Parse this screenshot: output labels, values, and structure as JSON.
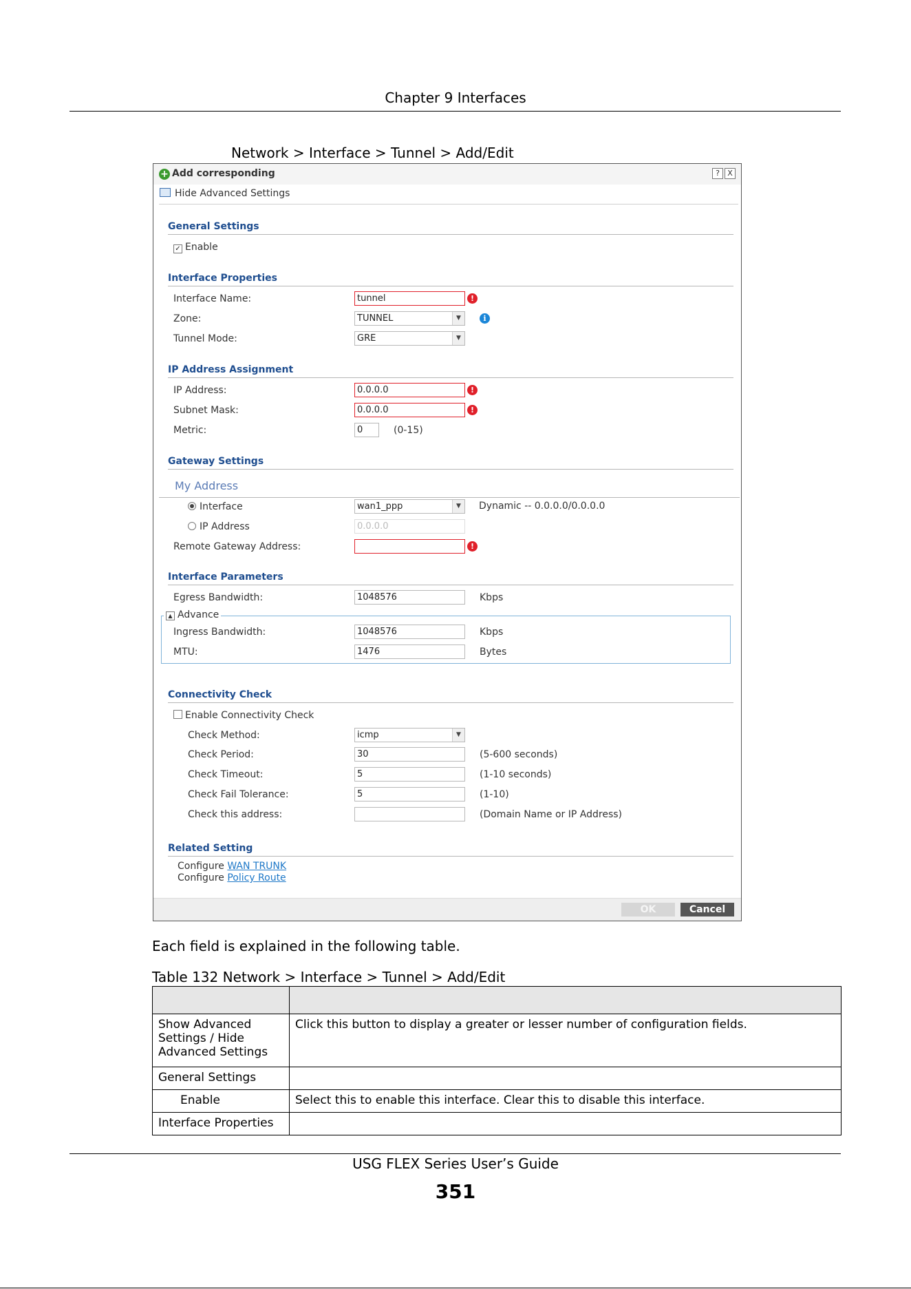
{
  "header": {
    "chapter": "Chapter 9 Interfaces"
  },
  "figure_caption": "Network > Interface > Tunnel > Add/Edit",
  "dialog": {
    "title": "Add corresponding",
    "help_btn": "?",
    "close_btn": "X",
    "adv_toggle": "Hide Advanced Settings",
    "general": {
      "title": "General Settings",
      "enable_label": "Enable",
      "enable_checked": true
    },
    "iface_props": {
      "title": "Interface Properties",
      "name_label": "Interface Name:",
      "name_value": "tunnel",
      "zone_label": "Zone:",
      "zone_value": "TUNNEL",
      "mode_label": "Tunnel Mode:",
      "mode_value": "GRE"
    },
    "ip_assign": {
      "title": "IP Address Assignment",
      "ip_label": "IP Address:",
      "ip_value": "0.0.0.0",
      "mask_label": "Subnet Mask:",
      "mask_value": "0.0.0.0",
      "metric_label": "Metric:",
      "metric_value": "0",
      "metric_hint": "(0-15)"
    },
    "gateway": {
      "title": "Gateway Settings",
      "my_address": "My Address",
      "iface_radio": "Interface",
      "iface_value": "wan1_ppp",
      "dynamic_text": "Dynamic -- 0.0.0.0/0.0.0.0",
      "ip_radio": "IP Address",
      "ip_value": "0.0.0.0",
      "remote_label": "Remote Gateway Address:",
      "remote_value": ""
    },
    "params": {
      "title": "Interface Parameters",
      "egress_label": "Egress Bandwidth:",
      "egress_value": "1048576",
      "egress_unit": "Kbps",
      "advance_label": "Advance",
      "ingress_label": "Ingress Bandwidth:",
      "ingress_value": "1048576",
      "ingress_unit": "Kbps",
      "mtu_label": "MTU:",
      "mtu_value": "1476",
      "mtu_unit": "Bytes"
    },
    "conn": {
      "title": "Connectivity Check",
      "enable_label": "Enable Connectivity Check",
      "enable_checked": false,
      "method_label": "Check Method:",
      "method_value": "icmp",
      "period_label": "Check Period:",
      "period_value": "30",
      "period_hint": "(5-600 seconds)",
      "timeout_label": "Check Timeout:",
      "timeout_value": "5",
      "timeout_hint": "(1-10 seconds)",
      "fail_label": "Check Fail Tolerance:",
      "fail_value": "5",
      "fail_hint": "(1-10)",
      "addr_label": "Check this address:",
      "addr_value": "",
      "addr_hint": "(Domain Name or IP Address)"
    },
    "related": {
      "title": "Related Setting",
      "configure": "Configure",
      "link1": "WAN TRUNK",
      "link2": "Policy Route"
    },
    "ok": "OK",
    "cancel": "Cancel"
  },
  "explain_text": "Each field is explained in the following table.",
  "table_caption": "Table 132   Network > Interface > Tunnel > Add/Edit",
  "table": {
    "header": [
      "",
      ""
    ],
    "rows": [
      {
        "label": "Show Advanced Settings / Hide Advanced Settings",
        "desc": "Click this button to display a greater or lesser number of configuration fields."
      },
      {
        "label": "General Settings",
        "desc": ""
      },
      {
        "label": "Enable",
        "desc": "Select this to enable this interface. Clear this to disable this interface."
      },
      {
        "label": "Interface Properties",
        "desc": ""
      }
    ]
  },
  "footer": {
    "guide": "USG FLEX Series User’s Guide",
    "page": "351"
  }
}
